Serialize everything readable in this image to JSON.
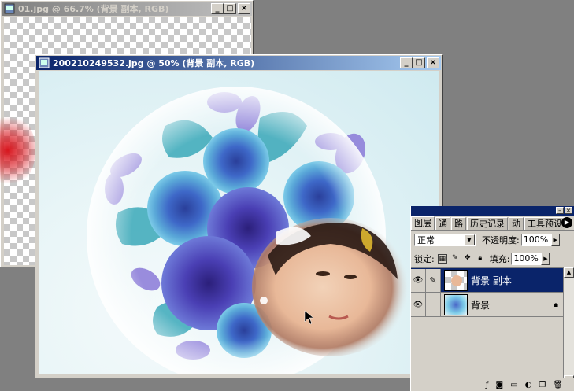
{
  "window_back": {
    "title": "01.jpg @ 66.7% (背景 副本, RGB)",
    "buttons": [
      "_",
      "□",
      "×"
    ]
  },
  "window_front": {
    "title": "200210249532.jpg @ 50% (背景 副本, RGB)",
    "buttons": [
      "_",
      "□",
      "×"
    ]
  },
  "layers_palette": {
    "tabs": [
      "图层",
      "通",
      "路",
      "历史记录",
      "动",
      "工具预设"
    ],
    "blend_mode": "正常",
    "opacity_label": "不透明度:",
    "opacity_value": "100%",
    "lock_label": "锁定:",
    "fill_label": "填充:",
    "fill_value": "100%",
    "layers": [
      {
        "name": "背景 副本",
        "selected": true,
        "visible": true
      },
      {
        "name": "背景",
        "selected": false,
        "visible": true,
        "locked": true
      }
    ]
  },
  "colors": {
    "title_active": "#0a246a",
    "title_inactive": "#808080",
    "workspace": "#808080",
    "chrome": "#d4d0c8"
  }
}
